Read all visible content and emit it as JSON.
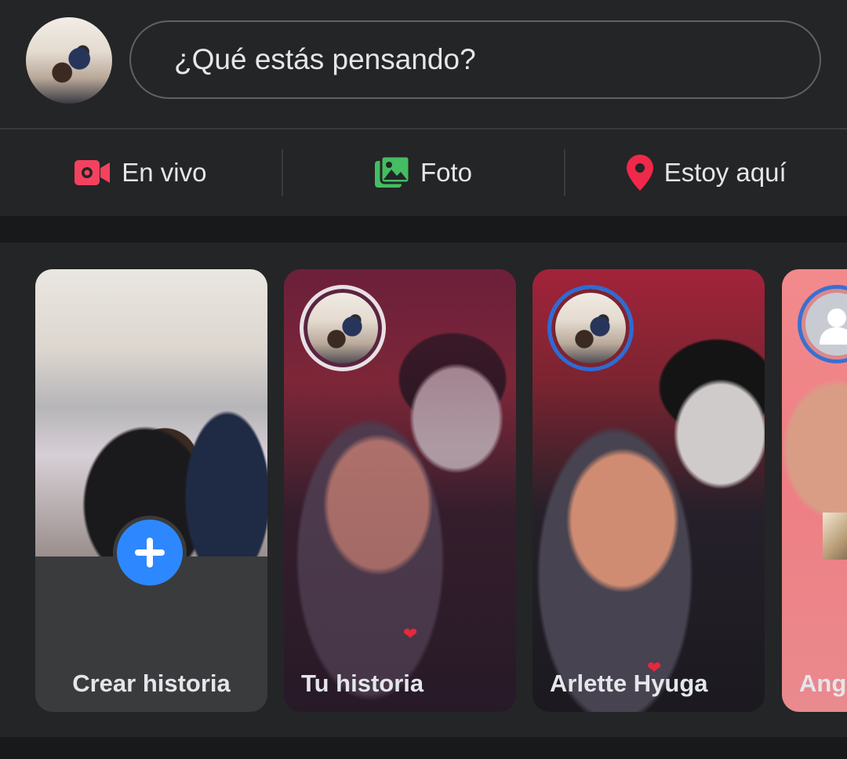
{
  "composer": {
    "placeholder": "¿Qué estás pensando?"
  },
  "actions": [
    {
      "label": "En vivo",
      "icon": "live-video-icon",
      "color": "#f3425f"
    },
    {
      "label": "Foto",
      "icon": "photo-icon",
      "color": "#45bd62"
    },
    {
      "label": "Estoy aquí",
      "icon": "location-pin-icon",
      "color": "#f02849"
    }
  ],
  "stories": {
    "create_label": "Crear historia",
    "items": [
      {
        "label": "Tu historia"
      },
      {
        "label": "Arlette Hyuga"
      },
      {
        "label": "Ange"
      }
    ]
  },
  "colors": {
    "background": "#18191a",
    "surface": "#242526",
    "accent": "#2d88ff",
    "text": "#e4e6eb"
  }
}
